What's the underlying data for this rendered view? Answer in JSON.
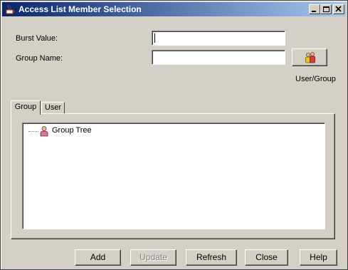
{
  "window": {
    "title": "Access List Member Selection"
  },
  "form": {
    "burst_label": "Burst Value:",
    "burst_value": "",
    "group_label": "Group Name:",
    "group_value": "",
    "user_group_label": "User/Group"
  },
  "tabs": [
    {
      "label": "Group",
      "active": true
    },
    {
      "label": "User",
      "active": false
    }
  ],
  "tree": {
    "root_label": "Group Tree"
  },
  "buttons": {
    "add": "Add",
    "update": "Update",
    "refresh": "Refresh",
    "close": "Close",
    "help": "Help"
  },
  "colors": {
    "titlebar_start": "#0a246a",
    "titlebar_end": "#a6caf0",
    "face": "#d4d0c8"
  }
}
